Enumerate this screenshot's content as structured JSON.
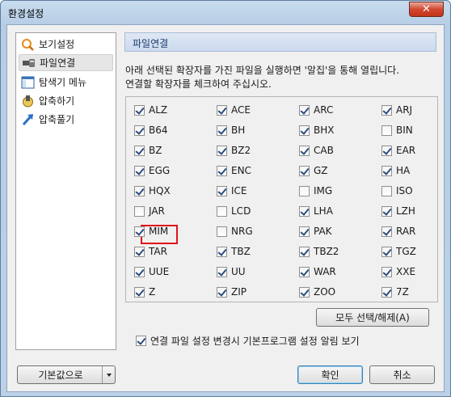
{
  "window": {
    "title": "환경설정",
    "close_label": "✕"
  },
  "sidebar": {
    "items": [
      {
        "label": "보기설정",
        "icon": "magnifier-icon"
      },
      {
        "label": "파일연결",
        "icon": "file-link-icon"
      },
      {
        "label": "탐색기 메뉴",
        "icon": "explorer-window-icon"
      },
      {
        "label": "압축하기",
        "icon": "compress-icon"
      },
      {
        "label": "압축풀기",
        "icon": "extract-arrow-icon"
      }
    ],
    "active_index": 1
  },
  "panel": {
    "title": "파일연결",
    "description_line1": "아래 선택된 확장자를 가진 파일을 실행하면 '알집'을 통해 열립니다.",
    "description_line2": "연결할 확장자를 체크하여 주십시오."
  },
  "extensions": [
    {
      "label": "ALZ",
      "checked": true
    },
    {
      "label": "ACE",
      "checked": true
    },
    {
      "label": "ARC",
      "checked": true
    },
    {
      "label": "ARJ",
      "checked": true
    },
    {
      "label": "B64",
      "checked": true
    },
    {
      "label": "BH",
      "checked": true
    },
    {
      "label": "BHX",
      "checked": true
    },
    {
      "label": "BIN",
      "checked": false
    },
    {
      "label": "BZ",
      "checked": true
    },
    {
      "label": "BZ2",
      "checked": true
    },
    {
      "label": "CAB",
      "checked": true
    },
    {
      "label": "EAR",
      "checked": true
    },
    {
      "label": "EGG",
      "checked": true
    },
    {
      "label": "ENC",
      "checked": true
    },
    {
      "label": "GZ",
      "checked": true
    },
    {
      "label": "HA",
      "checked": true
    },
    {
      "label": "HQX",
      "checked": true
    },
    {
      "label": "ICE",
      "checked": true
    },
    {
      "label": "IMG",
      "checked": false
    },
    {
      "label": "ISO",
      "checked": false
    },
    {
      "label": "JAR",
      "checked": false
    },
    {
      "label": "LCD",
      "checked": false
    },
    {
      "label": "LHA",
      "checked": true
    },
    {
      "label": "LZH",
      "checked": true
    },
    {
      "label": "MIM",
      "checked": true
    },
    {
      "label": "NRG",
      "checked": false
    },
    {
      "label": "PAK",
      "checked": true
    },
    {
      "label": "RAR",
      "checked": true
    },
    {
      "label": "TAR",
      "checked": true
    },
    {
      "label": "TBZ",
      "checked": true
    },
    {
      "label": "TBZ2",
      "checked": true
    },
    {
      "label": "TGZ",
      "checked": true
    },
    {
      "label": "UUE",
      "checked": true
    },
    {
      "label": "UU",
      "checked": true
    },
    {
      "label": "WAR",
      "checked": true
    },
    {
      "label": "XXE",
      "checked": true
    },
    {
      "label": "Z",
      "checked": true
    },
    {
      "label": "ZIP",
      "checked": true
    },
    {
      "label": "ZOO",
      "checked": true
    },
    {
      "label": "7Z",
      "checked": true
    }
  ],
  "buttons": {
    "select_all": "모두 선택/해제(A)",
    "defaults": "기본값으로",
    "ok": "확인",
    "cancel": "취소"
  },
  "notify_checkbox": {
    "label": "연결 파일 설정 변경시 기본프로그램 설정 알림 보기",
    "checked": true
  },
  "colors": {
    "highlight_border": "#e0141c",
    "header_text": "#1d3c6e"
  }
}
